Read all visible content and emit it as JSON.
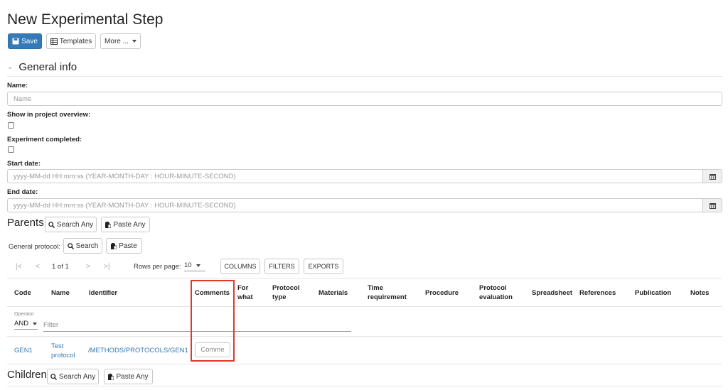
{
  "page": {
    "title": "New Experimental Step"
  },
  "toolbar": {
    "save_label": "Save",
    "templates_label": "Templates",
    "more_label": "More ..."
  },
  "general_info": {
    "title": "General info",
    "name": {
      "label": "Name:",
      "placeholder": "Name"
    },
    "show_in_overview": {
      "label": "Show in project overview:"
    },
    "experiment_completed": {
      "label": "Experiment completed:"
    },
    "start_date": {
      "label": "Start date:",
      "placeholder": "yyyy-MM-dd HH:mm:ss (YEAR-MONTH-DAY : HOUR-MINUTE-SECOND)"
    },
    "end_date": {
      "label": "End date:",
      "placeholder": "yyyy-MM-dd HH:mm:ss (YEAR-MONTH-DAY : HOUR-MINUTE-SECOND)"
    }
  },
  "parents": {
    "title": "Parents",
    "search_any": "Search Any",
    "paste_any": "Paste Any",
    "general_protocol": {
      "label": "General protocol:",
      "search": "Search",
      "paste": "Paste"
    }
  },
  "grid": {
    "pager": {
      "first": "|<",
      "prev": "<",
      "page_info": "1 of 1",
      "next": ">",
      "last": ">|"
    },
    "rows_per_page_label": "Rows per page:",
    "rows_per_page_value": "10",
    "columns_btn": "COLUMNS",
    "filters_btn": "FILTERS",
    "exports_btn": "EXPORTS",
    "headers": {
      "code": "Code",
      "name": "Name",
      "identifier": "Identifier",
      "comments": "Comments",
      "for_what_1": "For",
      "for_what_2": "what",
      "protocol_type_1": "Protocol",
      "protocol_type_2": "type",
      "materials": "Materials",
      "time_req_1": "Time",
      "time_req_2": "requirement",
      "procedure": "Procedure",
      "protocol_eval_1": "Protocol",
      "protocol_eval_2": "evaluation",
      "spreadsheet": "Spreadsheet",
      "references": "References",
      "publication": "Publication",
      "notes": "Notes"
    },
    "filter": {
      "operator_label": "Operator",
      "operator_value": "AND",
      "placeholder": "Filter"
    },
    "rows": [
      {
        "code": "GEN1",
        "name_1": "Test",
        "name_2": "protocol",
        "identifier": "/METHODS/PROTOCOLS/GEN1",
        "comments_placeholder": "Comme"
      }
    ]
  },
  "children": {
    "title": "Children",
    "search_any": "Search Any",
    "paste_any": "Paste Any"
  },
  "colors": {
    "primary": "#337ab7",
    "highlight": "#e0392b",
    "link": "#337ab7"
  }
}
